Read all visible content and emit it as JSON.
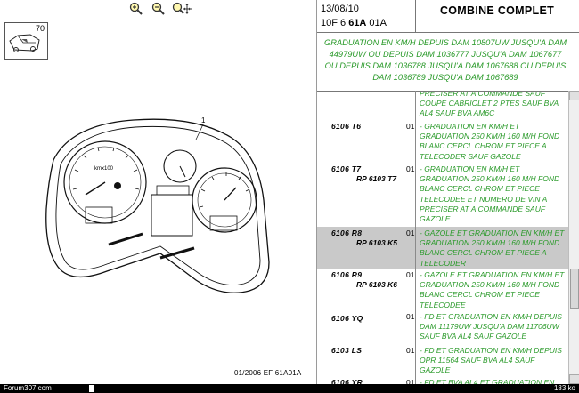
{
  "toolbar": {
    "zoom_in": "zoom-in",
    "zoom_out": "zoom-out",
    "zoom_pan": "zoom-pan"
  },
  "ref_box": {
    "number": "70"
  },
  "diagram": {
    "callout": "1",
    "gauge_label": "kmx100",
    "ref": "01/2006  EF 61A01A"
  },
  "header": {
    "date": "13/08/10",
    "code_prefix": "10F 6 ",
    "code_bold": "61A",
    "code_suffix": " 01A",
    "title": "COMBINE COMPLET"
  },
  "notice": "GRADUATION EN KM/H DEPUIS DAM 10807UW JUSQU'A DAM 44979UW OU DEPUIS DAM 1036777 JUSQU'A DAM 1067677 OU DEPUIS DAM 1036788 JUSQU'A DAM 1067688 OU DEPUIS DAM 1036789 JUSQU'A DAM 1067689",
  "rows": [
    {
      "ref": "",
      "rp": "",
      "qty": "",
      "desc": "PRECISER AT A COMMANDE SAUF COUPE CABRIOLET 2 PTES SAUF BVA AL4 SAUF BVA AM6C"
    },
    {
      "ref": "6106 T6",
      "rp": "",
      "qty": "01",
      "desc": "- GRADUATION EN KM/H ET GRADUATION 250 KM/H 160 M/H FOND BLANC CERCL CHROM ET PIECE A TELECODER SAUF GAZOLE"
    },
    {
      "ref": "6106 T7",
      "rp": "RP 6103 T7",
      "qty": "01",
      "desc": "- GRADUATION EN KM/H ET GRADUATION 250 KM/H 160 M/H FOND BLANC CERCL CHROM ET PIECE TELECODEE ET NUMERO DE VIN A PRECISER AT A COMMANDE SAUF GAZOLE"
    },
    {
      "ref": "6106 R8",
      "rp": "RP 6103 K5",
      "qty": "01",
      "desc": "- GAZOLE ET GRADUATION EN KM/H ET GRADUATION 250 KM/H 160 M/H FOND BLANC CERCL CHROM ET PIECE A TELECODER"
    },
    {
      "ref": "6106 R9",
      "rp": "RP 6103 K6",
      "qty": "01",
      "desc": "- GAZOLE ET GRADUATION EN KM/H ET GRADUATION 250 KM/H 160 M/H FOND BLANC CERCL CHROM ET PIECE TELECODEE"
    },
    {
      "ref": "6106 YQ",
      "rp": "",
      "qty": "01",
      "desc": "- FD ET GRADUATION EN KM/H DEPUIS DAM 11179UW JUSQU'A DAM 11706UW SAUF BVA AL4 SAUF GAZOLE"
    },
    {
      "ref": "6103 LS",
      "rp": "",
      "qty": "01",
      "desc": "- FD ET GRADUATION EN KM/H DEPUIS OPR 11564 SAUF BVA AL4 SAUF GAZOLE"
    },
    {
      "ref": "6106 YR",
      "rp": "",
      "qty": "01",
      "desc": "- FD ET BVA AL4 ET GRADUATION EN"
    }
  ],
  "status": {
    "left": "Forum307.com",
    "right": "183 ko"
  },
  "colors": {
    "green_text": "#2a9a2a",
    "selected_row": "#c9c9c9"
  }
}
